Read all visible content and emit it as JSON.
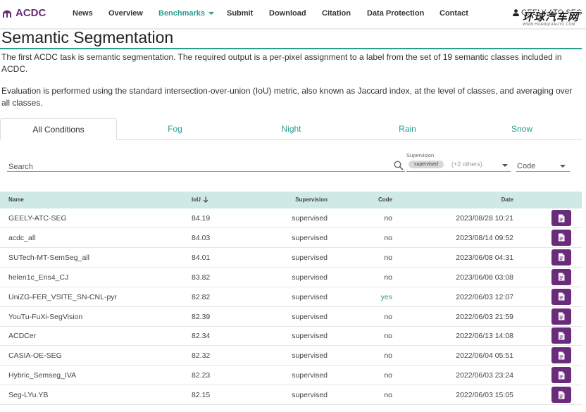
{
  "nav": {
    "brand": "ACDC",
    "items": [
      "News",
      "Overview",
      "Benchmarks",
      "Submit",
      "Download",
      "Citation",
      "Data Protection",
      "Contact"
    ],
    "active": "Benchmarks",
    "user": "GEELY-ATC-SEG"
  },
  "watermark": {
    "big": "环球汽车网",
    "small": "WWW.HUANQIUAUTO.COM"
  },
  "page": {
    "title": "Semantic Segmentation",
    "para1": "The first ACDC task is semantic segmentation. The required output is a per-pixel assignment to a label from the set of 19 semantic classes included in ACDC.",
    "para2": "Evaluation is performed using the standard intersection-over-union (IoU) metric, also known as Jaccard index, at the level of classes, and averaging over all classes."
  },
  "tabs": [
    "All Conditions",
    "Fog",
    "Night",
    "Rain",
    "Snow"
  ],
  "filters": {
    "search_label": "Search",
    "supervision_label": "Supervision",
    "supervision_chip": "supervised",
    "supervision_others": "(+2 others)",
    "code_label": "Code"
  },
  "table": {
    "headers": {
      "name": "Name",
      "iou": "IoU",
      "supervision": "Supervision",
      "code": "Code",
      "date": "Date"
    },
    "rows": [
      {
        "name": "GEELY-ATC-SEG",
        "iou": "84.19",
        "supervision": "supervised",
        "code": "no",
        "date": "2023/08/28 10:21"
      },
      {
        "name": "acdc_all",
        "iou": "84.03",
        "supervision": "supervised",
        "code": "no",
        "date": "2023/08/14 09:52"
      },
      {
        "name": "SUTech-MT-SemSeg_all",
        "iou": "84.01",
        "supervision": "supervised",
        "code": "no",
        "date": "2023/06/08 04:31"
      },
      {
        "name": "helen1c_Ens4_CJ",
        "iou": "83.82",
        "supervision": "supervised",
        "code": "no",
        "date": "2023/06/08 03:08"
      },
      {
        "name": "UniZG-FER_VSITE_SN-CNL-pyr",
        "iou": "82.82",
        "supervision": "supervised",
        "code": "yes",
        "date": "2022/06/03 12:07"
      },
      {
        "name": "YouTu-FuXi-SegVision",
        "iou": "82.39",
        "supervision": "supervised",
        "code": "no",
        "date": "2022/06/03 21:59"
      },
      {
        "name": "ACDCer",
        "iou": "82.34",
        "supervision": "supervised",
        "code": "no",
        "date": "2022/06/13 14:08"
      },
      {
        "name": "CASIA-OE-SEG",
        "iou": "82.32",
        "supervision": "supervised",
        "code": "no",
        "date": "2022/06/04 05:51"
      },
      {
        "name": "Hybric_Semseg_IVA",
        "iou": "82.23",
        "supervision": "supervised",
        "code": "no",
        "date": "2022/06/03 23:24"
      },
      {
        "name": "Seg-LYu.YB",
        "iou": "82.15",
        "supervision": "supervised",
        "code": "no",
        "date": "2022/06/03 15:05"
      }
    ]
  },
  "colors": {
    "brand": "#6a2c7a",
    "accent": "#2a9d8f",
    "header_bg": "#cfe9e6"
  }
}
